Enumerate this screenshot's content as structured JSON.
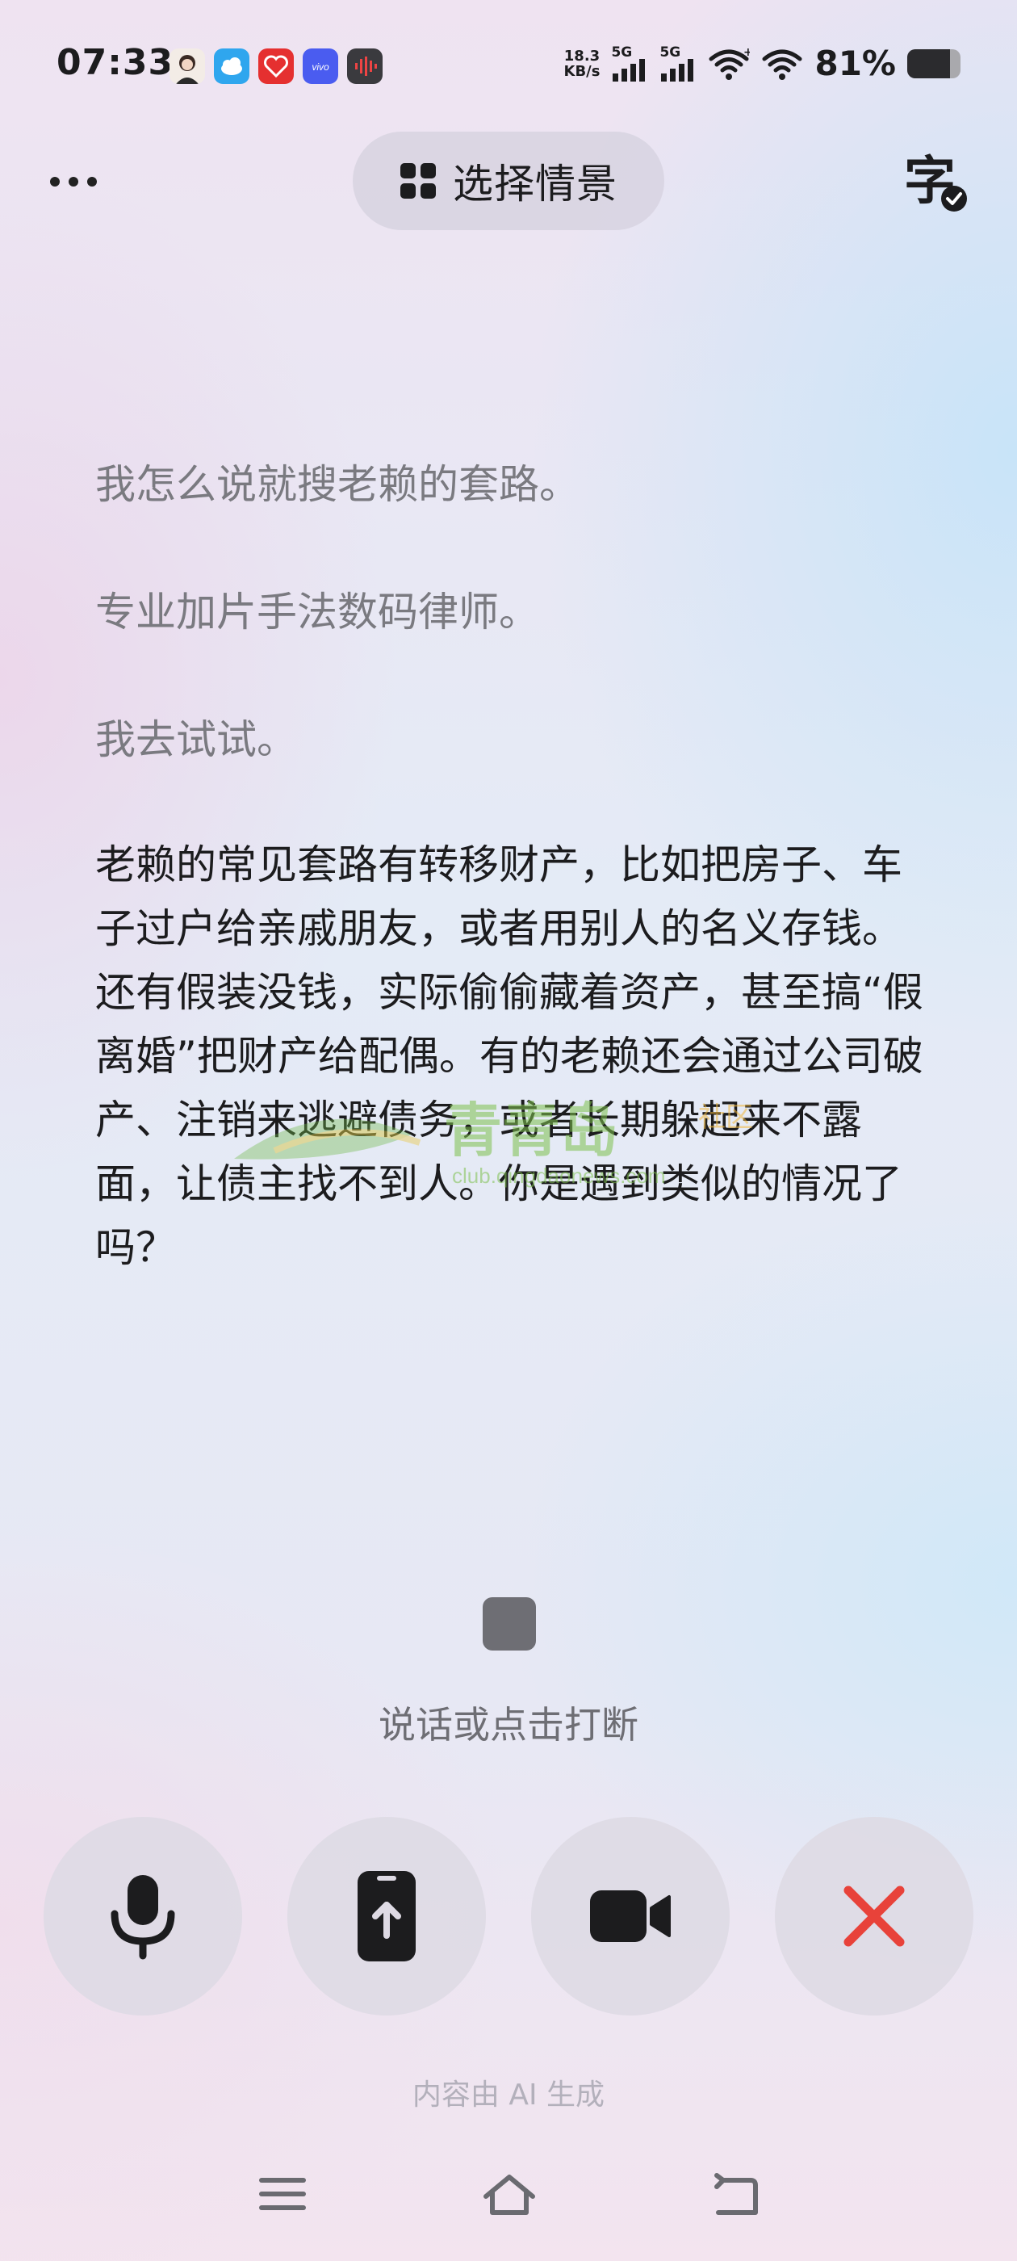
{
  "status_bar": {
    "time": "07:33",
    "net_speed_value": "18.3",
    "net_speed_unit": "KB/s",
    "sim1_label": "5G",
    "sim2_label": "5G",
    "battery_percent": "81%",
    "battery_level": 0.81,
    "notification_icons": [
      "avatar-app-icon",
      "cloud-app-icon",
      "heart-app-icon",
      "vivo-app-icon",
      "voice-recorder-icon"
    ]
  },
  "header": {
    "scene_button_label": "选择情景"
  },
  "transcript": {
    "user_lines": [
      "我怎么说就搜老赖的套路。",
      "专业加片手法数码律师。",
      "我去试试。"
    ],
    "ai_reply": "老赖的常见套路有转移财产，比如把房子、车子过户给亲戚朋友，或者用别人的名义存钱。还有假装没钱，实际偷偷藏着资产，甚至搞“假离婚”把财产给配偶。有的老赖还会通过公司破产、注销来逃避债务，或者长期躲起来不露面，让债主找不到人。你是遇到类似的情况了吗？"
  },
  "watermark": {
    "brand": "青青岛",
    "tag": "社区",
    "url": "club.qingdaonews.com"
  },
  "hint": "说话或点击打断",
  "controls": {
    "mic": "microphone-icon",
    "share": "share-screen-icon",
    "video": "video-camera-icon",
    "close": "close-icon",
    "close_color": "#e8423a"
  },
  "footer_note": "内容由 AI 生成"
}
